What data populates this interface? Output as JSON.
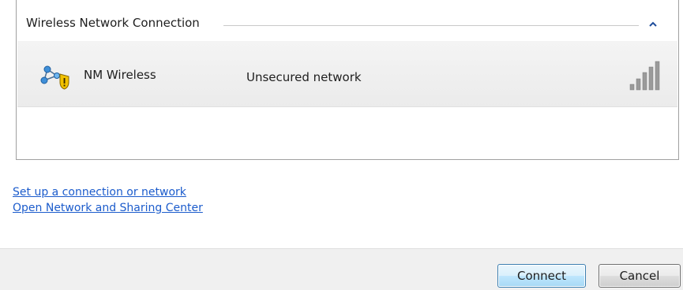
{
  "network_list": {
    "group_title": "Wireless Network Connection",
    "collapse_icon": "chevron-up-icon",
    "networks": [
      {
        "name": "NM Wireless",
        "security": "Unsecured network",
        "icon": "unsecured-network-icon",
        "signal_bars": 5,
        "signal_max": 5
      }
    ]
  },
  "links": {
    "setup": "Set up a connection or network",
    "sharing_center": "Open Network and Sharing Center"
  },
  "footer": {
    "connect_label": "Connect",
    "cancel_label": "Cancel"
  },
  "colors": {
    "link": "#1c5ccc",
    "chevron": "#1f4e9c",
    "signal_bar": "#9a9a9a",
    "shield_yellow": "#f2c200"
  }
}
